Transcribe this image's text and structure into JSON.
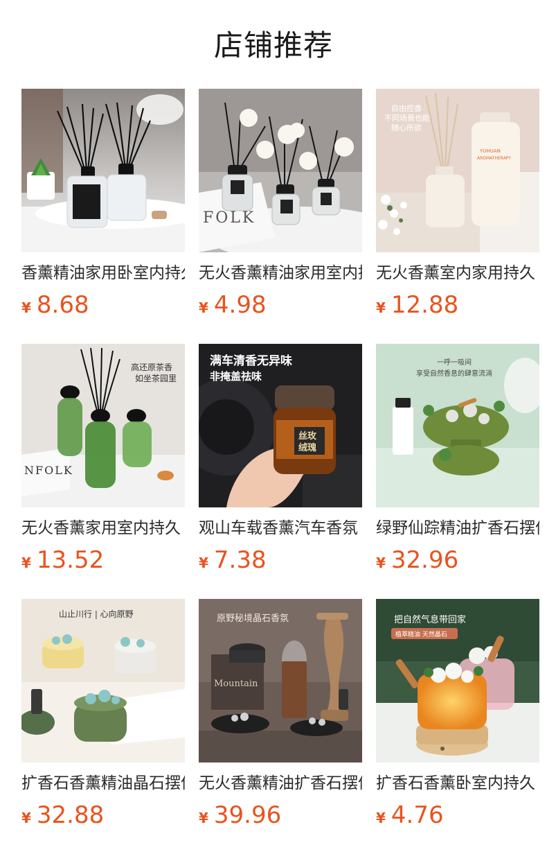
{
  "header": {
    "title": "店铺推荐"
  },
  "currency": "¥",
  "products": [
    {
      "name": "香薰精油家用卧室内持久",
      "price": "8.68",
      "icon": "reed-diffuser-black-bottles-image",
      "overlay": []
    },
    {
      "name": "无火香薰精油家用室内持",
      "price": "4.98",
      "icon": "reed-diffuser-white-flowers-image",
      "overlay": [
        "FOLK"
      ]
    },
    {
      "name": "无火香薰室内家用持久",
      "price": "12.88",
      "icon": "reed-diffuser-beige-bottles-image",
      "overlay": [
        "自由控香",
        "不同场景也能",
        "随心所欲",
        "YUHUAN",
        "AROMATHERAPY"
      ]
    },
    {
      "name": "无火香薰家用室内持久",
      "price": "13.52",
      "icon": "reed-diffuser-green-bottles-image",
      "overlay": [
        "高还原茶香",
        "如坐茶园里",
        "NFOLK"
      ]
    },
    {
      "name": "观山车载香薰汽车香氛",
      "price": "7.38",
      "icon": "car-aroma-jar-image",
      "overlay": [
        "满车清香无异味",
        "非掩盖祛味",
        "丝玫",
        "绒瑰"
      ]
    },
    {
      "name": "绿野仙踪精油扩香石摆件",
      "price": "32.96",
      "icon": "diffuser-stone-green-image",
      "overlay": [
        "一呼一吸间",
        "享受自然香息的肆意流淌"
      ]
    },
    {
      "name": "扩香石香薰精油晶石摆件",
      "price": "32.88",
      "icon": "crystal-stone-bowls-image",
      "overlay": [
        "山止川行 | 心向原野"
      ]
    },
    {
      "name": "无火香薰精油扩香石摆件",
      "price": "39.96",
      "icon": "crystal-stone-dark-set-image",
      "overlay": [
        "原野秘境晶石香氛",
        "Mountain"
      ]
    },
    {
      "name": "扩香石香薰卧室内持久",
      "price": "4.76",
      "icon": "crystal-lamp-glow-image",
      "overlay": [
        "把自然气息带回家",
        "植萃精油 天然晶石"
      ]
    }
  ]
}
